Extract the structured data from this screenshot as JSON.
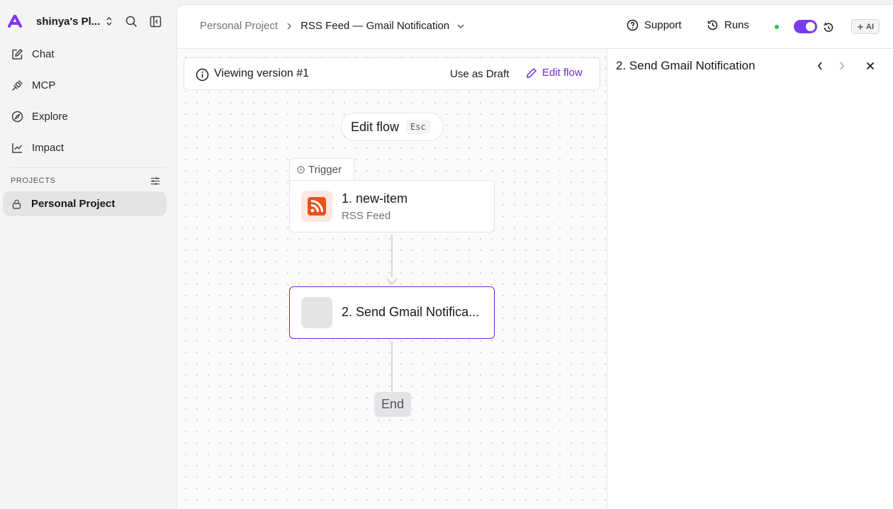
{
  "sidebar": {
    "workspace_name": "shinya's Pl...",
    "nav": [
      {
        "label": "Chat",
        "icon": "edit-icon"
      },
      {
        "label": "MCP",
        "icon": "plug-icon"
      },
      {
        "label": "Explore",
        "icon": "compass-icon"
      },
      {
        "label": "Impact",
        "icon": "line-chart-icon"
      }
    ],
    "projects_header": "PROJECTS",
    "project_name": "Personal Project"
  },
  "topbar": {
    "breadcrumb_project": "Personal Project",
    "breadcrumb_flow": "RSS Feed — Gmail Notification",
    "support_label": "Support",
    "runs_label": "Runs",
    "ai_label": "AI",
    "flow_enabled": true
  },
  "canvas": {
    "version_text": "Viewing version #1",
    "use_as_draft": "Use as Draft",
    "edit_flow": "Edit flow",
    "edit_pill_label": "Edit flow",
    "edit_pill_kbd": "Esc",
    "trigger_label": "Trigger",
    "step1_title": "1. new-item",
    "step1_sub": "RSS Feed",
    "step2_title": "2. Send Gmail Notifica...",
    "end_label": "End"
  },
  "panel": {
    "title": "2. Send Gmail Notification"
  },
  "colors": {
    "accent": "#6d28d9",
    "toggle": "#7c3aed",
    "status": "#22c55e",
    "rss": "#e8531a"
  }
}
